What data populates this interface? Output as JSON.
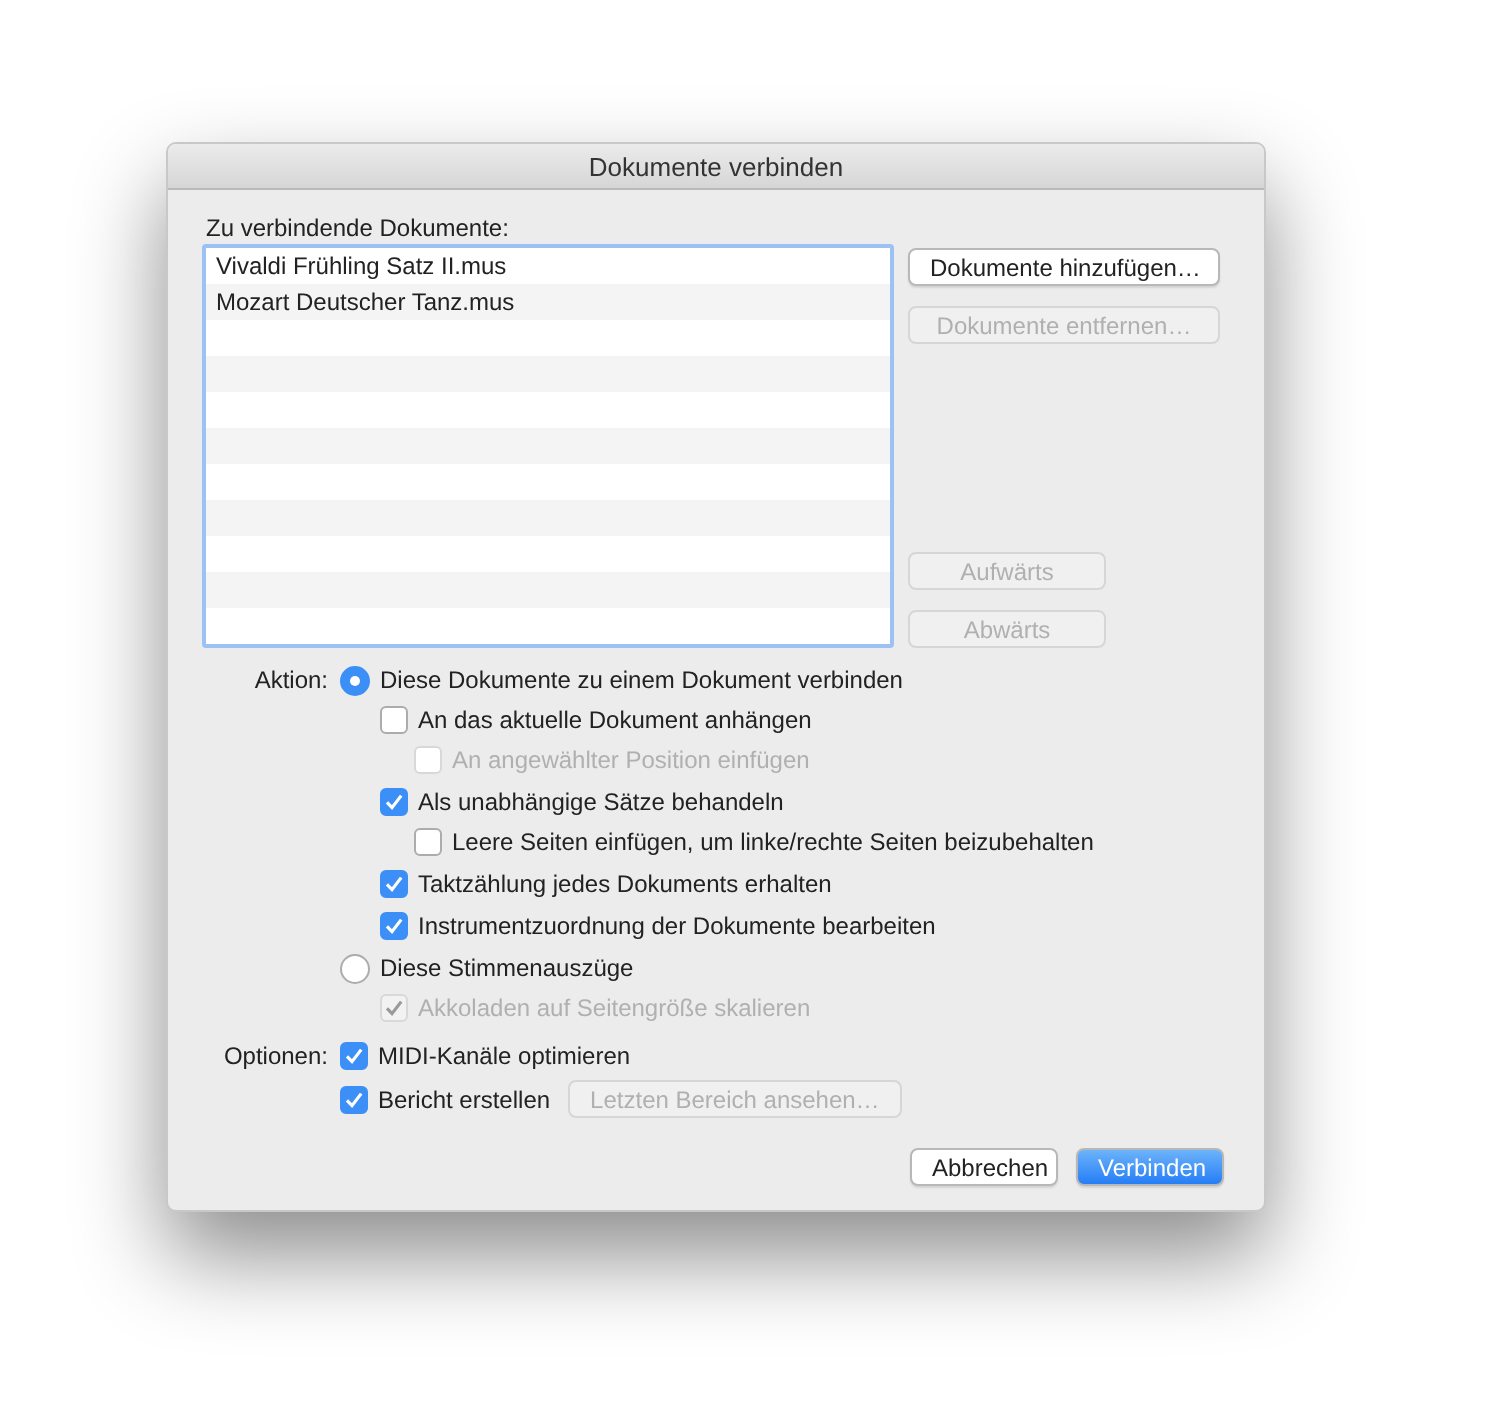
{
  "window": {
    "title": "Dokumente verbinden"
  },
  "documents": {
    "label": "Zu verbindende Dokumente:",
    "items": [
      {
        "name": "Vivaldi Frühling Satz II.mus",
        "selected": false
      },
      {
        "name": "Mozart Deutscher Tanz.mus",
        "selected": false
      }
    ]
  },
  "side_buttons": {
    "top": [
      {
        "label": "Dokumente hinzufügen…",
        "disabled": false
      },
      {
        "label": "Dokumente entfernen…",
        "disabled": true
      }
    ],
    "bottom": [
      {
        "label": "Aufwärts",
        "disabled": true
      },
      {
        "label": "Abwärts",
        "disabled": true
      }
    ]
  },
  "action": {
    "label": "Aktion:",
    "items": [
      {
        "kind": "radio",
        "label": "Diese Dokumente zu einem Dokument verbinden",
        "selected": true,
        "disabled": false,
        "children": [
          {
            "kind": "checkbox",
            "label": "An das aktuelle Dokument anhängen",
            "checked": false,
            "disabled": false,
            "children": [
              {
                "kind": "checkbox",
                "label": "An angewählter Position einfügen",
                "checked": false,
                "disabled": true
              }
            ]
          },
          {
            "kind": "checkbox",
            "label": "Als unabhängige Sätze behandeln",
            "checked": true,
            "disabled": false,
            "children": [
              {
                "kind": "checkbox",
                "label": "Leere Seiten einfügen, um linke/rechte Seiten beizubehalten",
                "checked": false,
                "disabled": false
              }
            ]
          },
          {
            "kind": "checkbox",
            "label": "Taktzählung jedes Dokuments erhalten",
            "checked": true,
            "disabled": false
          },
          {
            "kind": "checkbox",
            "label": "Instrumentzuordnung der Dokumente bearbeiten",
            "checked": true,
            "disabled": false
          }
        ]
      },
      {
        "kind": "radio",
        "label": "Diese Stimmenauszüge",
        "selected": false,
        "disabled": false,
        "children": [
          {
            "kind": "checkbox",
            "label": "Akkoladen auf Seitengröße skalieren",
            "checked": true,
            "disabled": true
          }
        ]
      }
    ]
  },
  "options": {
    "label": "Optionen:",
    "items": [
      {
        "kind": "checkbox",
        "label": "MIDI-Kanäle optimieren",
        "checked": true,
        "disabled": false
      },
      {
        "kind": "checkbox",
        "label": "Bericht erstellen",
        "checked": true,
        "disabled": false,
        "button": {
          "label": "Letzten Bereich ansehen…",
          "disabled": true
        }
      }
    ]
  },
  "footer_buttons": [
    {
      "label": "Abbrechen",
      "primary": false
    },
    {
      "label": "Verbinden",
      "primary": true
    }
  ]
}
